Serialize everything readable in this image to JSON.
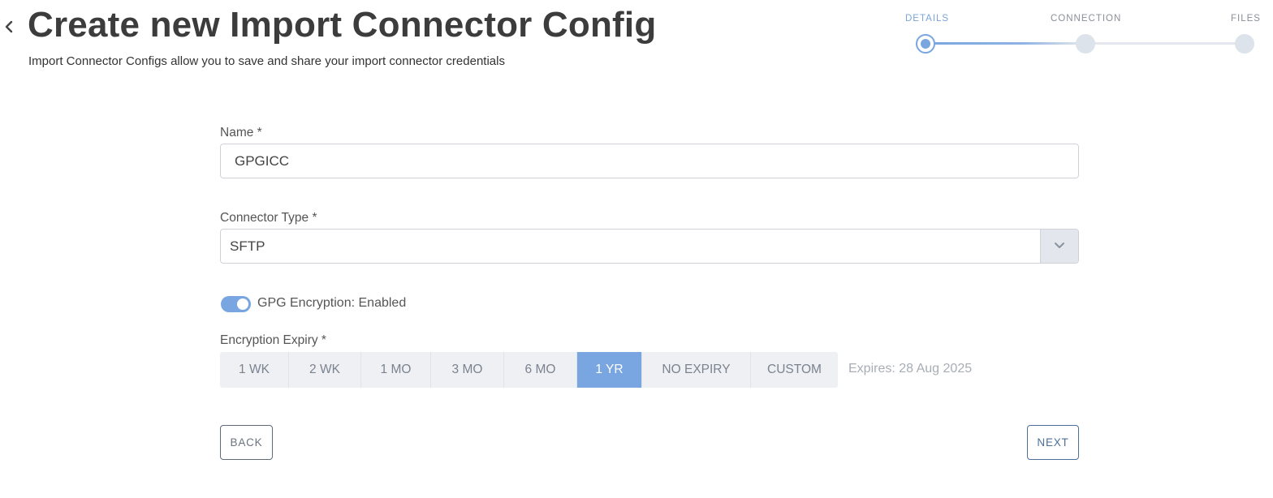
{
  "header": {
    "title": "Create new Import Connector Config",
    "subtitle": "Import Connector Configs allow you to save and share your import connector credentials"
  },
  "stepper": {
    "steps": [
      {
        "label": "DETAILS",
        "state": "active"
      },
      {
        "label": "CONNECTION",
        "state": "pending"
      },
      {
        "label": "FILES",
        "state": "pending"
      }
    ]
  },
  "form": {
    "name": {
      "label": "Name *",
      "value": "GPGICC"
    },
    "connector_type": {
      "label": "Connector Type *",
      "value": "SFTP"
    },
    "gpg": {
      "label": "GPG Encryption: Enabled",
      "enabled": true
    },
    "expiry": {
      "label": "Encryption Expiry *",
      "options": [
        "1 WK",
        "2 WK",
        "1 MO",
        "3 MO",
        "6 MO",
        "1 YR",
        "NO EXPIRY",
        "CUSTOM"
      ],
      "selected": "1 YR",
      "expires_text": "Expires: 28 Aug 2025"
    }
  },
  "actions": {
    "back_label": "BACK",
    "next_label": "NEXT"
  },
  "colors": {
    "accent": "#79a6e0",
    "text": "#3c3c3c",
    "muted": "#a8adb4"
  }
}
